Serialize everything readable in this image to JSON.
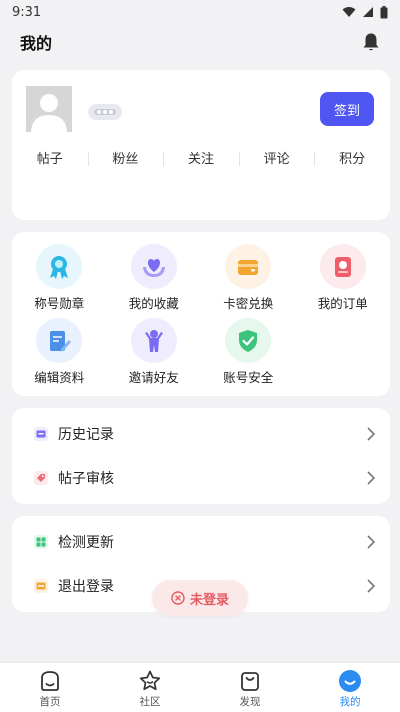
{
  "status_bar": {
    "time": "9:31"
  },
  "header": {
    "title": "我的"
  },
  "profile": {
    "checkin_label": "签到",
    "stats": [
      "帖子",
      "粉丝",
      "关注",
      "评论",
      "积分"
    ]
  },
  "features": [
    {
      "label": "称号勋章",
      "icon": "medal-icon",
      "color": "#2bb7e3",
      "bg": "#e6f6fc"
    },
    {
      "label": "我的收藏",
      "icon": "heart-hands-icon",
      "color": "#7b6cf2",
      "bg": "#efedfd"
    },
    {
      "label": "卡密兑换",
      "icon": "card-wallet-icon",
      "color": "#f3a531",
      "bg": "#fdf2e3"
    },
    {
      "label": "我的订单",
      "icon": "order-icon",
      "color": "#ef5f69",
      "bg": "#fdeaec"
    },
    {
      "label": "编辑资料",
      "icon": "edit-profile-icon",
      "color": "#4a8fe8",
      "bg": "#e8f1fd"
    },
    {
      "label": "邀请好友",
      "icon": "invite-friend-icon",
      "color": "#7b6cf2",
      "bg": "#efedfd"
    },
    {
      "label": "账号安全",
      "icon": "shield-check-icon",
      "color": "#3cc47c",
      "bg": "#e6f8ee"
    }
  ],
  "menu_group_1": [
    {
      "label": "历史记录",
      "icon": "history-icon",
      "color": "#7b6cf2"
    },
    {
      "label": "帖子审核",
      "icon": "review-tag-icon",
      "color": "#ef6a72"
    }
  ],
  "menu_group_2": [
    {
      "label": "检测更新",
      "icon": "update-icon",
      "color": "#3cc47c"
    },
    {
      "label": "退出登录",
      "icon": "logout-icon",
      "color": "#f3a531"
    }
  ],
  "toast": {
    "text": "未登录"
  },
  "bottom_nav": [
    {
      "label": "首页",
      "icon": "home-icon"
    },
    {
      "label": "社区",
      "icon": "star-icon"
    },
    {
      "label": "发现",
      "icon": "bag-icon"
    },
    {
      "label": "我的",
      "icon": "profile-icon"
    }
  ],
  "colors": {
    "accent": "#4f55f0",
    "nav_active": "#2a8cf0",
    "toast_text": "#e45b62"
  }
}
